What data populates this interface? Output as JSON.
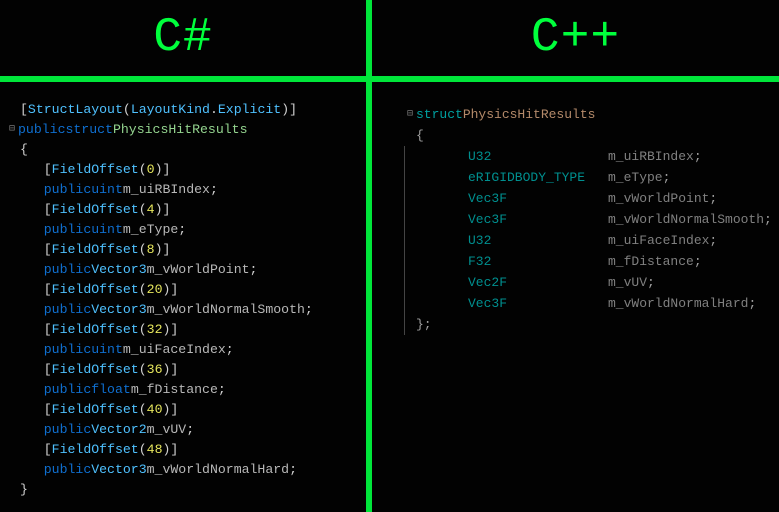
{
  "headers": {
    "left": "C#",
    "right": "C++"
  },
  "csharp": {
    "struct_attr": {
      "name": "StructLayout",
      "arg_type": "LayoutKind",
      "arg_member": "Explicit"
    },
    "decl_kw1": "public",
    "decl_kw2": "struct",
    "decl_name": "PhysicsHitResults",
    "field_attr": "FieldOffset",
    "fields": [
      {
        "offset": "0",
        "kw": "public",
        "type": "uint",
        "name": "m_uiRBIndex"
      },
      {
        "offset": "4",
        "kw": "public",
        "type": "uint",
        "name": "m_eType"
      },
      {
        "offset": "8",
        "kw": "public",
        "type": "Vector3",
        "name": "m_vWorldPoint"
      },
      {
        "offset": "20",
        "kw": "public",
        "type": "Vector3",
        "name": "m_vWorldNormalSmooth"
      },
      {
        "offset": "32",
        "kw": "public",
        "type": "uint",
        "name": "m_uiFaceIndex"
      },
      {
        "offset": "36",
        "kw": "public",
        "type": "float",
        "name": "m_fDistance"
      },
      {
        "offset": "40",
        "kw": "public",
        "type": "Vector2",
        "name": "m_vUV"
      },
      {
        "offset": "48",
        "kw": "public",
        "type": "Vector3",
        "name": "m_vWorldNormalHard"
      }
    ]
  },
  "cpp": {
    "kw": "struct",
    "name": "PhysicsHitResults",
    "fields": [
      {
        "type": "U32",
        "name": "m_uiRBIndex"
      },
      {
        "type": "eRIGIDBODY_TYPE",
        "name": "m_eType"
      },
      {
        "type": "Vec3F",
        "name": "m_vWorldPoint"
      },
      {
        "type": "Vec3F",
        "name": "m_vWorldNormalSmooth"
      },
      {
        "type": "U32",
        "name": "m_uiFaceIndex"
      },
      {
        "type": "F32",
        "name": "m_fDistance"
      },
      {
        "type": "Vec2F",
        "name": "m_vUV"
      },
      {
        "type": "Vec3F",
        "name": "m_vWorldNormalHard"
      }
    ]
  }
}
